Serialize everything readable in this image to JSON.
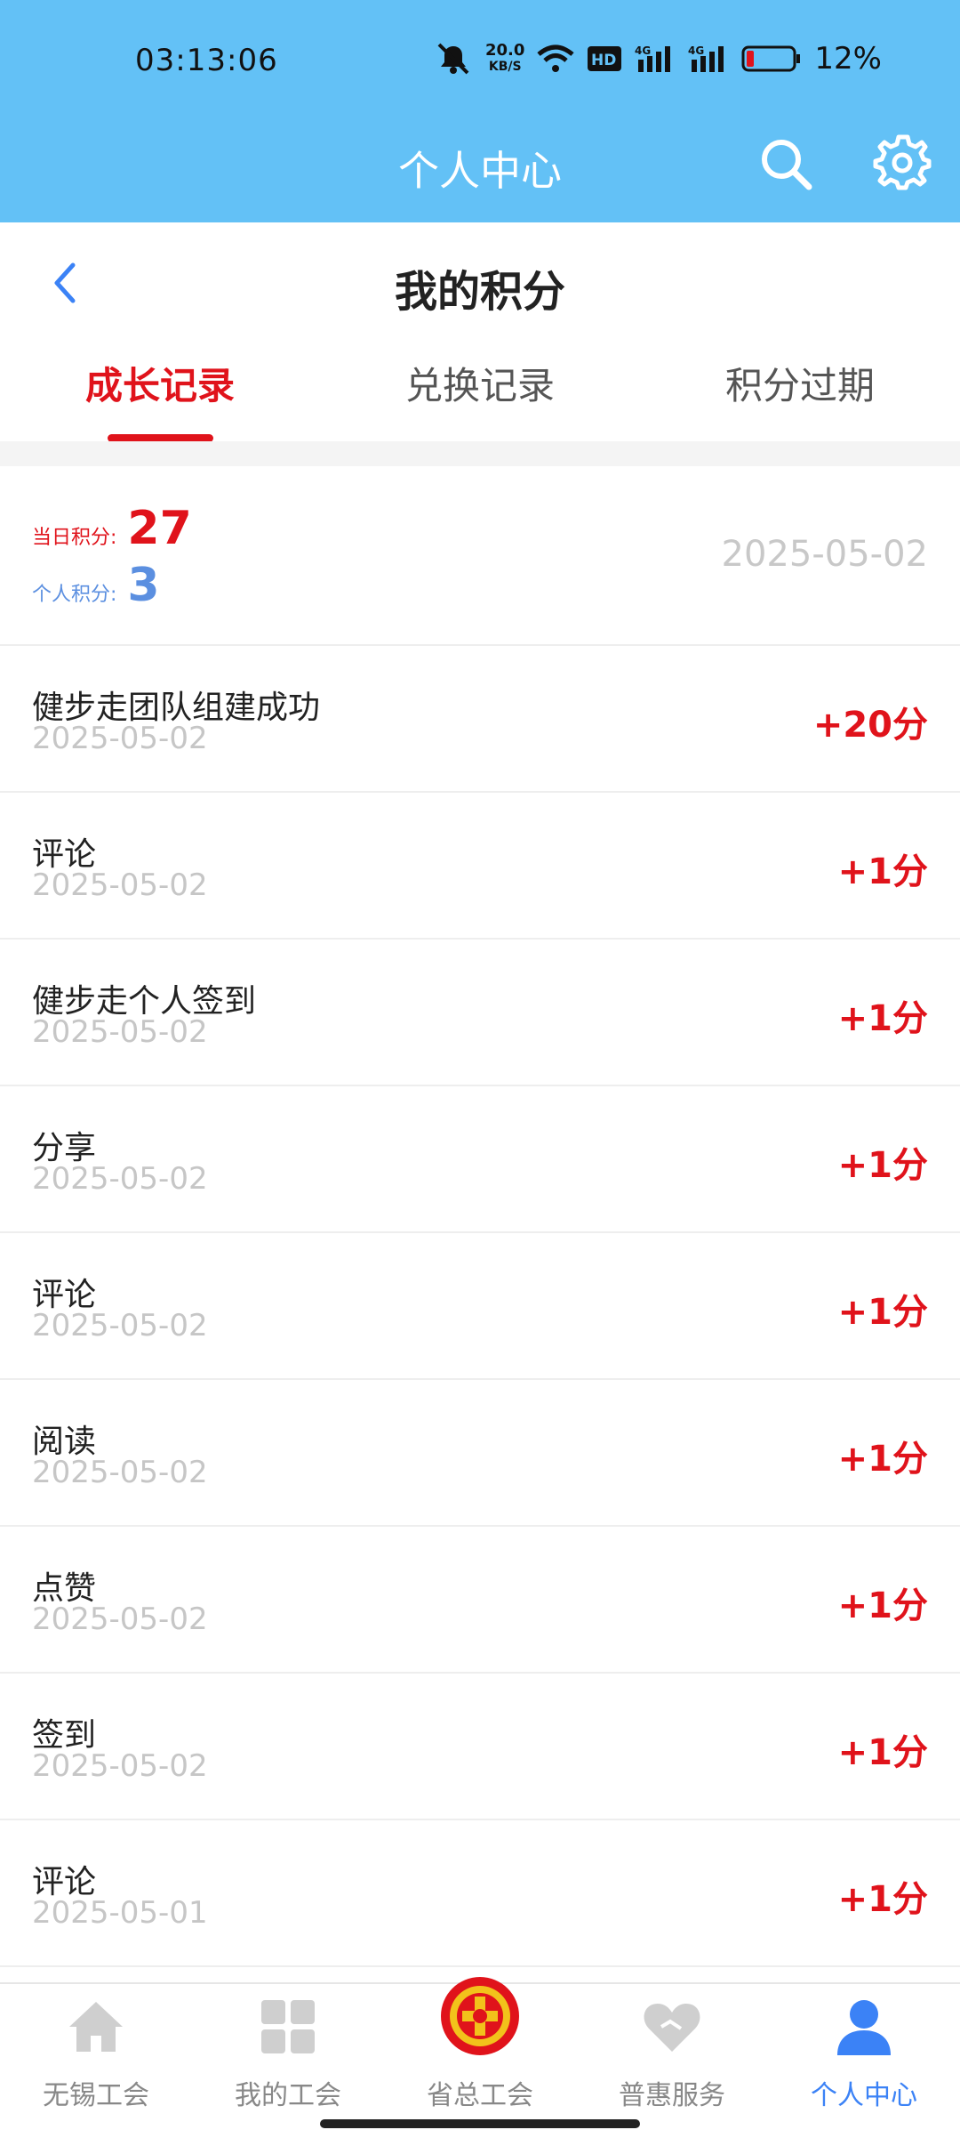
{
  "status": {
    "time": "03:13:06",
    "speed_value": "20.0",
    "speed_unit": "KB/S",
    "battery": "12%"
  },
  "appbar": {
    "title": "个人中心",
    "search_icon": "search-icon",
    "settings_icon": "gear-icon"
  },
  "subheader": {
    "title": "我的积分",
    "tabs": [
      {
        "label": "成长记录",
        "active": true
      },
      {
        "label": "兑换记录",
        "active": false
      },
      {
        "label": "积分过期",
        "active": false
      }
    ]
  },
  "summary": {
    "daily_label": "当日积分:",
    "daily_value": "27",
    "personal_label": "个人积分:",
    "personal_value": "3",
    "date": "2025-05-02",
    "colors": {
      "daily": "#e0131b",
      "personal": "#5b8fe0"
    }
  },
  "records": [
    {
      "title": "健步走团队组建成功",
      "date": "2025-05-02",
      "points": "+20分"
    },
    {
      "title": "评论",
      "date": "2025-05-02",
      "points": "+1分"
    },
    {
      "title": "健步走个人签到",
      "date": "2025-05-02",
      "points": "+1分"
    },
    {
      "title": "分享",
      "date": "2025-05-02",
      "points": "+1分"
    },
    {
      "title": "评论",
      "date": "2025-05-02",
      "points": "+1分"
    },
    {
      "title": "阅读",
      "date": "2025-05-02",
      "points": "+1分"
    },
    {
      "title": "点赞",
      "date": "2025-05-02",
      "points": "+1分"
    },
    {
      "title": "签到",
      "date": "2025-05-02",
      "points": "+1分"
    },
    {
      "title": "评论",
      "date": "2025-05-01",
      "points": "+1分"
    }
  ],
  "bottom_nav": [
    {
      "label": "无锡工会",
      "icon": "home-icon"
    },
    {
      "label": "我的工会",
      "icon": "grid-icon"
    },
    {
      "label": "省总工会",
      "icon": "union-emblem-icon"
    },
    {
      "label": "普惠服务",
      "icon": "heart-icon"
    },
    {
      "label": "个人中心",
      "icon": "person-icon",
      "active": true
    }
  ],
  "theme": {
    "header": "#63c1f6",
    "accent_red": "#e0131b",
    "active_blue": "#3b82f6"
  }
}
